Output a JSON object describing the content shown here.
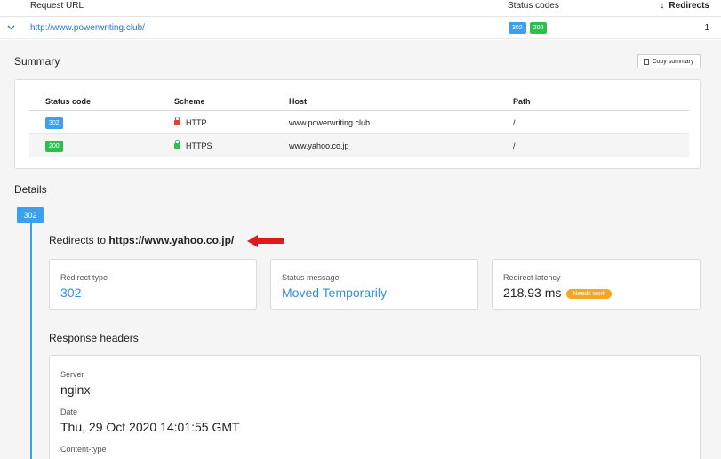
{
  "top_table": {
    "col_url": "Request URL",
    "col_codes": "Status codes",
    "col_redirects": "Redirects",
    "sort_arrow": "↓",
    "row": {
      "expand_icon": "chevron-down-icon",
      "url": "http://www.powerwriting.club/",
      "badges": [
        "302",
        "200"
      ],
      "redirects": "1"
    }
  },
  "summary": {
    "title": "Summary",
    "copy_label": "Copy summary",
    "headers": [
      "Status code",
      "Scheme",
      "Host",
      "Path"
    ],
    "rows": [
      {
        "code": "302",
        "scheme": "HTTP",
        "host": "www.powerwriting.club",
        "path": "/"
      },
      {
        "code": "200",
        "scheme": "HTTPS",
        "host": "www.yahoo.co.jp",
        "path": "/"
      }
    ]
  },
  "details": {
    "title": "Details",
    "step_badge": "302",
    "redirects_prefix": "Redirects to",
    "redirects_target": "https://www.yahoo.co.jp/",
    "cards": [
      {
        "label": "Redirect type",
        "value": "302"
      },
      {
        "label": "Status message",
        "value": "Moved Temporarily"
      },
      {
        "label": "Redirect latency",
        "value": "218.93 ms",
        "tag": "Needs work"
      }
    ],
    "response_headers_title": "Response headers",
    "headers": [
      {
        "name": "Server",
        "value": "nginx"
      },
      {
        "name": "Date",
        "value": "Thu, 29 Oct 2020 14:01:55 GMT"
      },
      {
        "name": "Content-type",
        "value": ""
      }
    ]
  },
  "colors": {
    "accent_blue": "#3ba0f0",
    "success_green": "#2fbf4f",
    "warning_orange": "#f5a623",
    "arrow_red": "#e01a1a"
  }
}
